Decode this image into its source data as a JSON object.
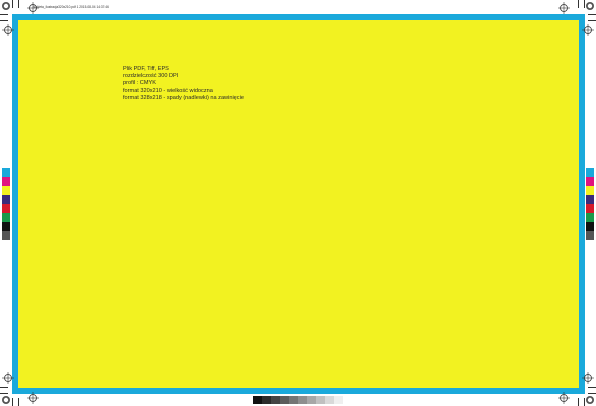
{
  "header": {
    "slug": "Nakleta_ilustracja320x210.pdf   1   2015-08-04   14:37:46"
  },
  "specs": {
    "line1": "Plik PDF, Tiff, EPS",
    "line2": "rozdzielczość 300 DPI",
    "line3": "profil : CMYK",
    "line4": "format 320x210 - wielkość widoczna",
    "line5": "format 328x218 - spady (nadlewki) na zawinięcie"
  },
  "colors": {
    "bleed": "#1aa9db",
    "trim": "#f2f221",
    "marks": "#333333"
  },
  "color_bar": [
    "#1aa9db",
    "#e0147f",
    "#f2f221",
    "#3a2b7a",
    "#d61a2b",
    "#1a9a4a",
    "#111111",
    "#555555"
  ],
  "gray_bar": [
    "#111111",
    "#2b2b2b",
    "#444444",
    "#5c5c5c",
    "#757575",
    "#8e8e8e",
    "#a7a7a7",
    "#c0c0c0",
    "#d9d9d9",
    "#efefef"
  ]
}
